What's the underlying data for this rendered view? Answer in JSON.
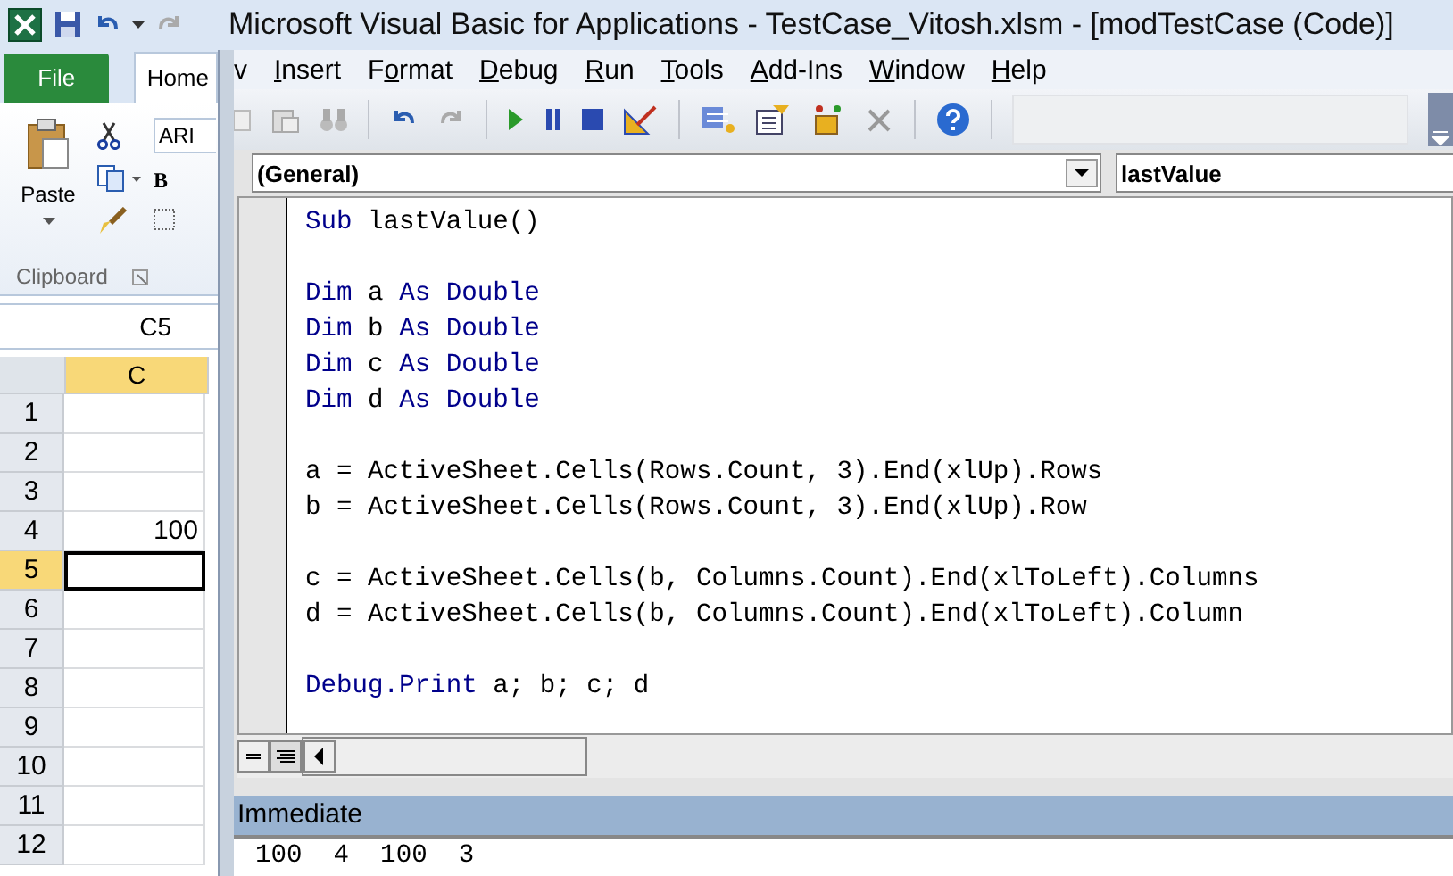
{
  "window": {
    "title": "Microsoft Visual Basic for Applications - TestCase_Vitosh.xlsm - [modTestCase (Code)]"
  },
  "excel": {
    "ribbon_tabs": [
      {
        "label": "File",
        "kind": "file",
        "selected": false
      },
      {
        "label": "Home",
        "kind": "tab",
        "selected": true
      }
    ],
    "paste_label": "Paste",
    "font_name": "ARI",
    "bold_label": "B",
    "group_label": "Clipboard",
    "name_box": "C5",
    "columns": [
      {
        "label": "C",
        "selected": true
      }
    ],
    "rows": [
      {
        "number": "1",
        "selected": false
      },
      {
        "number": "2",
        "selected": false
      },
      {
        "number": "3",
        "selected": false
      },
      {
        "number": "4",
        "value": "100",
        "selected": false
      },
      {
        "number": "5",
        "selected": true
      },
      {
        "number": "6",
        "selected": false
      },
      {
        "number": "7",
        "selected": false
      },
      {
        "number": "8",
        "selected": false
      },
      {
        "number": "9",
        "selected": false
      },
      {
        "number": "10",
        "selected": false
      },
      {
        "number": "11",
        "selected": false
      },
      {
        "number": "12",
        "selected": false
      }
    ]
  },
  "menu": [
    {
      "after": "v"
    },
    {
      "key": "I",
      "after": "nsert"
    },
    {
      "before": "F",
      "key": "o",
      "after": "rmat"
    },
    {
      "key": "D",
      "after": "ebug"
    },
    {
      "key": "R",
      "after": "un"
    },
    {
      "key": "T",
      "after": "ools"
    },
    {
      "key": "A",
      "after": "dd-Ins"
    },
    {
      "key": "W",
      "after": "indow"
    },
    {
      "key": "H",
      "after": "elp"
    }
  ],
  "object_box": "(General)",
  "procedure_box": "lastValue",
  "code": [
    {
      "kind": "code",
      "tokens": [
        {
          "kind": "keyword",
          "text": "Sub"
        },
        {
          "kind": "plain",
          "text": " lastValue()"
        }
      ]
    },
    {
      "kind": "blank"
    },
    {
      "kind": "code",
      "tokens": [
        {
          "kind": "keyword",
          "text": "Dim"
        },
        {
          "kind": "plain",
          "text": " a "
        },
        {
          "kind": "keyword",
          "text": "As Double"
        }
      ]
    },
    {
      "kind": "code",
      "tokens": [
        {
          "kind": "keyword",
          "text": "Dim"
        },
        {
          "kind": "plain",
          "text": " b "
        },
        {
          "kind": "keyword",
          "text": "As Double"
        }
      ]
    },
    {
      "kind": "code",
      "tokens": [
        {
          "kind": "keyword",
          "text": "Dim"
        },
        {
          "kind": "plain",
          "text": " c "
        },
        {
          "kind": "keyword",
          "text": "As Double"
        }
      ]
    },
    {
      "kind": "code",
      "tokens": [
        {
          "kind": "keyword",
          "text": "Dim"
        },
        {
          "kind": "plain",
          "text": " d "
        },
        {
          "kind": "keyword",
          "text": "As Double"
        }
      ]
    },
    {
      "kind": "blank"
    },
    {
      "kind": "code",
      "tokens": [
        {
          "kind": "plain",
          "text": "a = ActiveSheet.Cells(Rows.Count, 3).End(xlUp).Rows"
        }
      ]
    },
    {
      "kind": "code",
      "tokens": [
        {
          "kind": "plain",
          "text": "b = ActiveSheet.Cells(Rows.Count, 3).End(xlUp).Row"
        }
      ]
    },
    {
      "kind": "blank"
    },
    {
      "kind": "code",
      "tokens": [
        {
          "kind": "plain",
          "text": "c = ActiveSheet.Cells(b, Columns.Count).End(xlToLeft).Columns"
        }
      ]
    },
    {
      "kind": "code",
      "tokens": [
        {
          "kind": "plain",
          "text": "d = ActiveSheet.Cells(b, Columns.Count).End(xlToLeft).Column"
        }
      ]
    },
    {
      "kind": "blank"
    },
    {
      "kind": "code",
      "tokens": [
        {
          "kind": "keyword",
          "text": "Debug.Print"
        },
        {
          "kind": "plain",
          "text": " a; b; c; d"
        }
      ]
    }
  ],
  "immediate": {
    "title": "Immediate",
    "output": "100  4  100  3"
  }
}
